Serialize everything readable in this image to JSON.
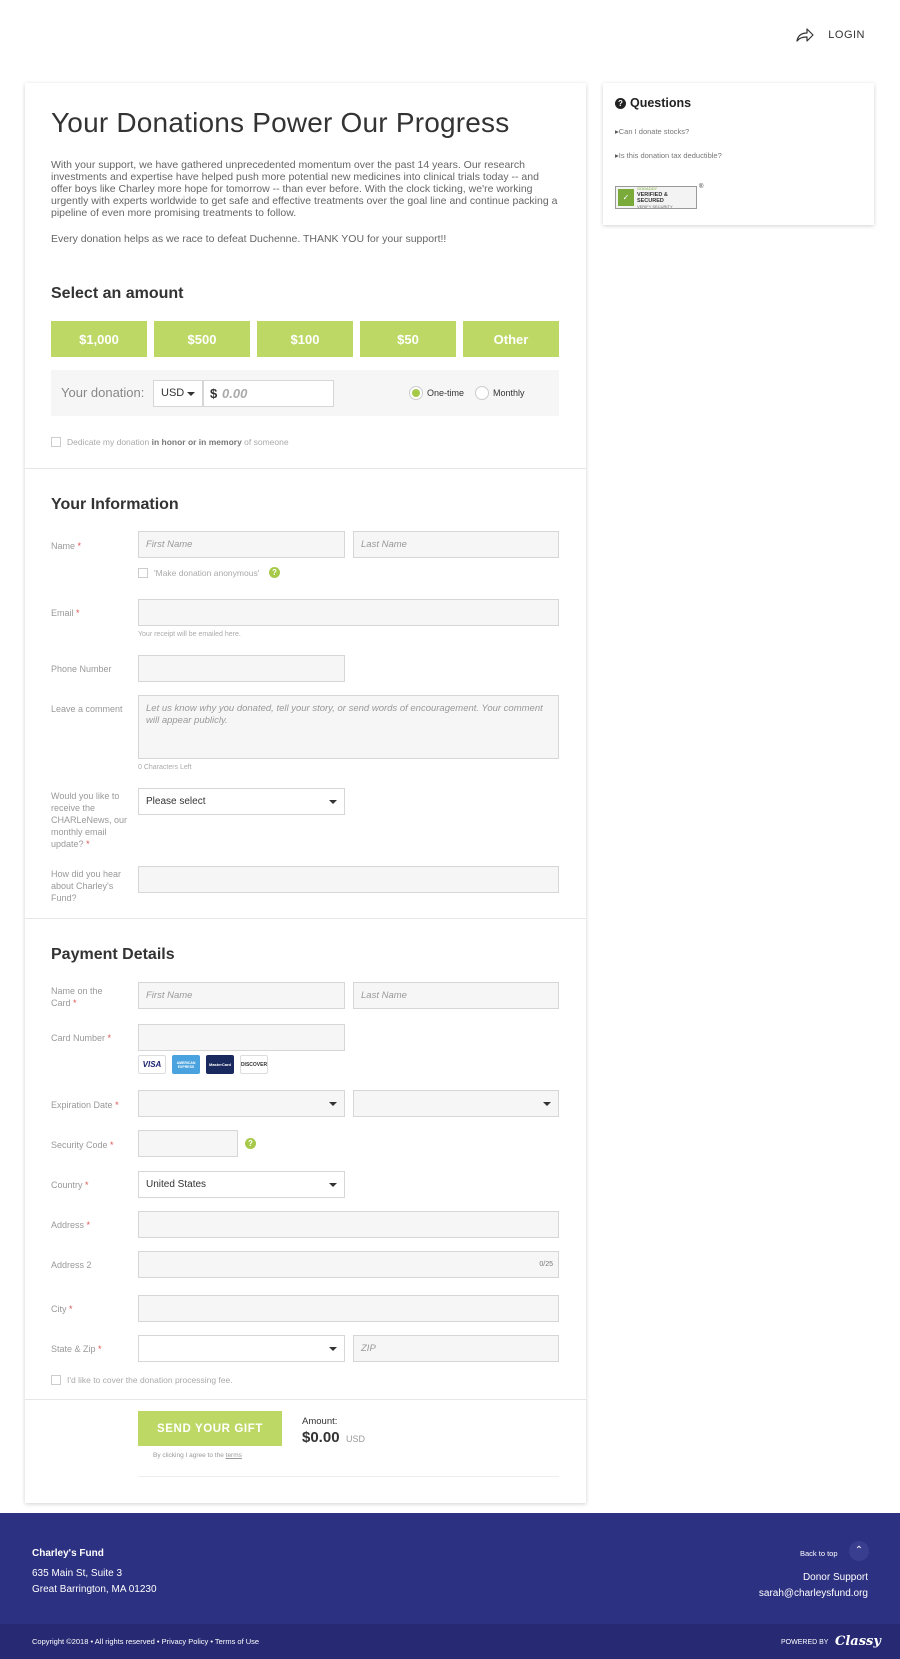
{
  "header": {
    "login_label": "LOGIN"
  },
  "main": {
    "title": "Your Donations Power Our Progress",
    "intro": "With your support, we have gathered unprecedented momentum over the past 14 years. Our research investments and expertise have helped push more potential new medicines into clinical trials today -- and offer boys like Charley more hope for tomorrow -- than ever before. With the clock ticking, we're working urgently with experts worldwide to get safe and effective treatments over the goal line and continue packing a pipeline of even more promising treatments to follow.",
    "intro2": "Every donation helps as we race to defeat Duchenne. THANK YOU for your support!!"
  },
  "amount": {
    "heading": "Select an amount",
    "options": [
      "$1,000",
      "$500",
      "$100",
      "$50",
      "Other"
    ],
    "your_donation_label": "Your donation:",
    "currency": "USD",
    "dollar_sign": "$",
    "amount_placeholder": "0.00",
    "frequency": [
      "One-time",
      "Monthly"
    ],
    "selected_frequency": "One-time",
    "dedicate_prefix": "Dedicate my donation",
    "dedicate_bold": "in honor or in memory",
    "dedicate_suffix": "of someone"
  },
  "info": {
    "heading": "Your Information",
    "name_label": "Name",
    "first_name_ph": "First Name",
    "last_name_ph": "Last Name",
    "anonymous_label": "'Make donation anonymous'",
    "email_label": "Email",
    "email_hint": "Your receipt will be emailed here.",
    "phone_label": "Phone Number",
    "comment_label": "Leave a comment",
    "comment_ph": "Let us know why you donated, tell your story, or send words of encouragement. Your comment will appear publicly.",
    "chars_left": "0 Characters Left",
    "newsletter_label": "Would you like to receive the CHARLeNews, our monthly email update?",
    "newsletter_value": "Please select",
    "hear_label": "How did you hear about Charley's Fund?",
    "required_mark": "*"
  },
  "payment": {
    "heading": "Payment Details",
    "name_label": "Name on the Card",
    "first_name_ph": "First Name",
    "last_name_ph": "Last Name",
    "card_label": "Card Number",
    "cards": [
      "VISA",
      "AMERICAN EXPRESS",
      "MasterCard",
      "DISCOVER"
    ],
    "exp_label": "Expiration Date",
    "security_label": "Security Code",
    "country_label": "Country",
    "country_value": "United States",
    "address_label": "Address",
    "address2_label": "Address 2",
    "address2_counter": "0/25",
    "city_label": "City",
    "state_zip_label": "State & Zip",
    "zip_ph": "ZIP",
    "cover_fee_label": "I'd like to cover the donation processing fee."
  },
  "submit": {
    "button_label": "SEND YOUR GIFT",
    "amount_label": "Amount:",
    "amount_value": "$0.00",
    "amount_currency": "USD",
    "terms_prefix": "By clicking I agree to the",
    "terms_link": "terms"
  },
  "sidebar": {
    "title": "Questions",
    "links": [
      "Can I donate stocks?",
      "Is this donation tax deductible?"
    ],
    "badge_top": "GODADDY",
    "badge_main": "VERIFIED & SECURED",
    "badge_sub": "VERIFY SECURITY",
    "badge_reg": "®"
  },
  "footer": {
    "org_name": "Charley's Fund",
    "address1": "635 Main St, Suite 3",
    "address2": "Great Barrington, MA 01230",
    "back_to_top": "Back to top",
    "support_label": "Donor Support",
    "support_email": "sarah@charleysfund.org",
    "copyright": "Copyright ©2018 • All rights reserved • Privacy Policy • Terms of Use",
    "powered_by": "POWERED BY",
    "brand": "Classy"
  },
  "colors": {
    "accent_green": "#bdd865",
    "footer_blue": "#2d3181",
    "required_red": "#d9534f"
  }
}
